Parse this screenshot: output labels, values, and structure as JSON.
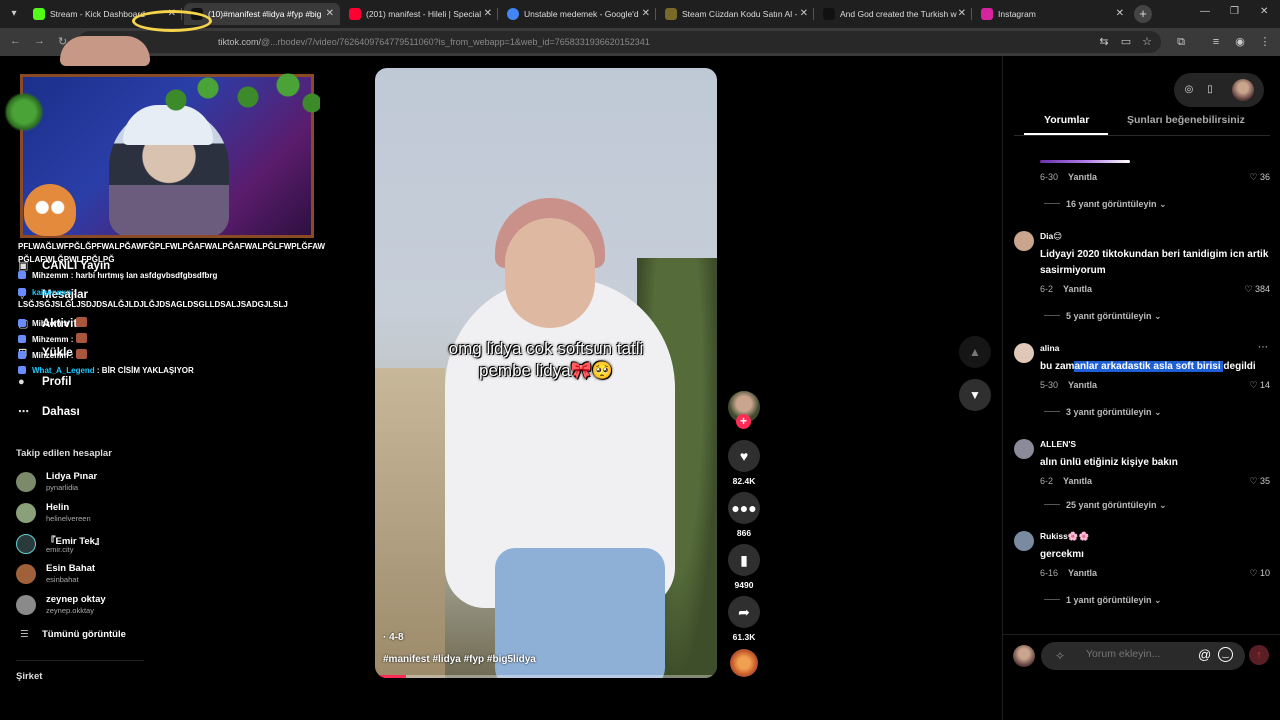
{
  "browser": {
    "tabs": [
      {
        "title": "Stream - Kick Dashboard",
        "color": "#53fc18"
      },
      {
        "title": "(10)#manifest #lidya #fyp #big",
        "color": "#111111"
      },
      {
        "title": "(201) manifest - Hileli | Special",
        "color": "#ff0033"
      },
      {
        "title": "Unstable medemek - Google'd",
        "color": "#4285f4"
      },
      {
        "title": "Steam Cüzdan Kodu Satın Al - ",
        "color": "#7a6a2a"
      },
      {
        "title": "And God created the Turkish w",
        "color": "#111111"
      },
      {
        "title": "Instagram",
        "color": "#d6249f"
      }
    ],
    "url_prefix": "tiktok.com/",
    "url": "@...rbodev/7/video/7626409764779511060?is_from_webapp=1&web_id=7658331936620152341"
  },
  "sidebar": {
    "nav": [
      {
        "label": "CANLI Yayın",
        "icon": "live-icon"
      },
      {
        "label": "Mesajlar",
        "icon": "message-icon"
      },
      {
        "label": "Aktivite",
        "icon": "activity-icon"
      },
      {
        "label": "Yükle",
        "icon": "upload-icon"
      },
      {
        "label": "Profil",
        "icon": "profile-icon"
      },
      {
        "label": "Dahası",
        "icon": "more-icon"
      }
    ],
    "following_header": "Takip edilen hesaplar",
    "following": [
      {
        "name": "Lidya Pınar",
        "user": "pynarlidia",
        "color": "#7a8a6a"
      },
      {
        "name": "Helin",
        "user": "helinelvereen",
        "color": "#8aa07a"
      },
      {
        "name": "『Emir Tek』",
        "user": "emir.city",
        "color": "#2a3a3a"
      },
      {
        "name": "Esin Bahat",
        "user": "esinbahat",
        "color": "#a0603a"
      },
      {
        "name": "zeynep oktay",
        "user": "zeynep.okktay",
        "color": "#8a8a8a"
      }
    ],
    "see_all": "Tümünü görüntüle",
    "company": "Şirket"
  },
  "stream_chat": {
    "lines": [
      {
        "user": "",
        "text": "PFLWAĞLWFPĞLĞPFWALPĞAWFĞPLFWLPĞAFWALPĞAFWALPĞLFWPLĞFAW"
      },
      {
        "user": "",
        "text": "PĞLAFWLĞPWLFPĞLPĞ"
      },
      {
        "user": "Mihzemm",
        "text": ": harbi hırtmış lan asfdgvbsdfgbsdfbrg"
      },
      {
        "user": "kaisennxn",
        "text": ":"
      },
      {
        "user": "",
        "text": "LSĞJSĞJSLĞLJSDJDSALĞJLDJLĞJDSAGLDSGLLDSALJSADGJLSLJ"
      },
      {
        "user": "Mihzemm",
        "text": ":"
      },
      {
        "user": "Mihzemm",
        "text": ":"
      },
      {
        "user": "Mihzemm",
        "text": ":"
      },
      {
        "user": "What_A_Legend",
        "text": ": BİR CİSİM YAKLAŞIYOR"
      }
    ]
  },
  "video": {
    "caption_line1": "omg lidya cok softsun tatli",
    "caption_line2": "pembe lidya🎀🥺",
    "date": "4-8",
    "hashtags": "#manifest #lidya #fyp #big5lidya",
    "progress": 0.08
  },
  "actions": {
    "likes": "82.4K",
    "comments": "866",
    "saves": "9490",
    "shares": "61.3K"
  },
  "panel": {
    "tab_comments": "Yorumlar",
    "tab_suggested": "Şunları beğenebilirsiniz",
    "first_meta": {
      "date": "6-30",
      "reply": "Yanıtla",
      "likes": "36",
      "replies": "16 yanıt görüntüleyin"
    },
    "comments": [
      {
        "name": "Dia😊",
        "text": "Lidyayi 2020 tiktokundan beri tanidigim icn artik sasirmiyorum",
        "date": "6-2",
        "reply": "Yanıtla",
        "likes": "384",
        "replies": "5 yanıt görüntüleyin",
        "color": "#c9a58e"
      },
      {
        "name": "alina",
        "text_before": "bu zam",
        "text_highlight": "anlar arkadastik asla soft birisi ",
        "text_after": "degildi",
        "date": "5-30",
        "reply": "Yanıtla",
        "likes": "14",
        "replies": "3 yanıt görüntüleyin",
        "color": "#e0c8b8"
      },
      {
        "name": "ALLEN'S",
        "text": "alın ünlü etiğiniz kişiye bakın",
        "date": "6-2",
        "reply": "Yanıtla",
        "likes": "35",
        "replies": "25 yanıt görüntüleyin",
        "color": "#8a8a9a"
      },
      {
        "name": "Rukiss🌸🌸",
        "text": "gercekmı",
        "date": "6-16",
        "reply": "Yanıtla",
        "likes": "10",
        "replies": "1 yanıt görüntüleyin",
        "color": "#7a8aa0"
      }
    ],
    "composer_placeholder": "Yorum ekleyin..."
  }
}
